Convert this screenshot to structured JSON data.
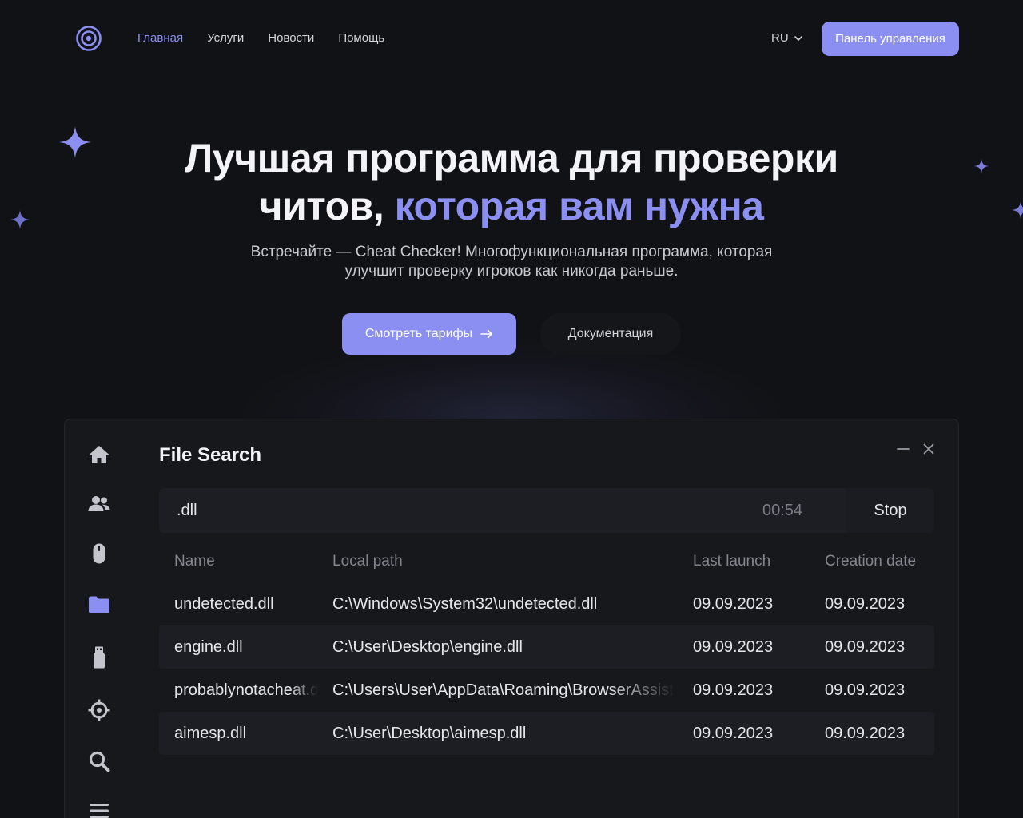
{
  "nav": {
    "links": [
      {
        "label": "Главная",
        "active": true
      },
      {
        "label": "Услуги",
        "active": false
      },
      {
        "label": "Новости",
        "active": false
      },
      {
        "label": "Помощь",
        "active": false
      }
    ],
    "language": "RU",
    "panel_button": "Панель управления"
  },
  "hero": {
    "title_line1": "Лучшая программа для проверки",
    "title_line2_plain": "читов, ",
    "title_line2_accent": "которая вам нужна",
    "subtitle_line1": "Встречайте — Cheat Checker! Многофункциональная программа, которая",
    "subtitle_line2": "улучшит проверку игроков как никогда раньше.",
    "primary_button": "Смотреть тарифы",
    "secondary_button": "Документация"
  },
  "app": {
    "title": "File Search",
    "search": {
      "value": ".dll",
      "timer": "00:54",
      "stop_label": "Stop"
    },
    "columns": [
      "Name",
      "Local path",
      "Last launch",
      "Creation date"
    ],
    "rows": [
      {
        "name": "undetected.dll",
        "path": "C:\\Windows\\System32\\undetected.dll",
        "last_launch": "09.09.2023",
        "created": "09.09.2023"
      },
      {
        "name": "engine.dll",
        "path": "C:\\User\\Desktop\\engine.dll",
        "last_launch": "09.09.2023",
        "created": "09.09.2023"
      },
      {
        "name": "probablynotacheat.dll",
        "path": "C:\\Users\\User\\AppData\\Roaming\\BrowserAssist.dll",
        "last_launch": "09.09.2023",
        "created": "09.09.2023"
      },
      {
        "name": "aimesp.dll",
        "path": "C:\\User\\Desktop\\aimesp.dll",
        "last_launch": "09.09.2023",
        "created": "09.09.2023"
      }
    ],
    "sidebar_icons": [
      "home-icon",
      "users-icon",
      "mouse-icon",
      "folder-icon",
      "usb-drive-icon",
      "crosshair-icon",
      "search-icon",
      "menu-icon"
    ]
  },
  "colors": {
    "background": "#111215",
    "accent": "#8b8ff1",
    "window": "#17181c",
    "row_alt": "#1d1e23"
  }
}
